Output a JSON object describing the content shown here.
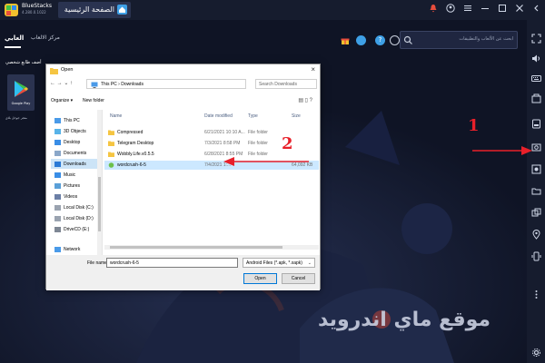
{
  "app": {
    "name": "BlueStacks",
    "version": "4.280.0.1022",
    "home_tab_label": "الصفحة الرئيسية"
  },
  "header": {
    "tab_top": "العابي",
    "tab_center": "مركز الالعاب",
    "search_placeholder": "ابحث عن الألعاب والتطبيقات"
  },
  "left_panel": {
    "title": "أضف طابع شخصي",
    "tile_label": "Google Play",
    "tile_caption": "متجر جوجل بلاي"
  },
  "dialog": {
    "title": "Open",
    "path": "This PC › Downloads",
    "search_placeholder": "Search Downloads",
    "organize_label": "Organize ▾",
    "new_folder_label": "New folder",
    "nav_items": [
      {
        "label": "This PC"
      },
      {
        "label": "3D Objects"
      },
      {
        "label": "Desktop"
      },
      {
        "label": "Documents"
      },
      {
        "label": "Downloads"
      },
      {
        "label": "Music"
      },
      {
        "label": "Pictures"
      },
      {
        "label": "Videos"
      },
      {
        "label": "Local Disk (C:)"
      },
      {
        "label": "Local Disk (D:)"
      },
      {
        "label": "DriveCD (E:)"
      },
      {
        "label": "Network"
      }
    ],
    "columns": {
      "name": "Name",
      "date": "Date modified",
      "type": "Type",
      "size": "Size"
    },
    "files": [
      {
        "name": "Compressed",
        "date": "6/21/2021 10:10 A...",
        "type": "File folder",
        "size": ""
      },
      {
        "name": "Telegram Desktop",
        "date": "7/3/2021 8:58 PM",
        "type": "File folder",
        "size": ""
      },
      {
        "name": "Wobbly.Life.v0.5.5",
        "date": "6/28/2021 8:55 PM",
        "type": "File folder",
        "size": ""
      },
      {
        "name": "wordcrush-6-5",
        "date": "7/4/2021 1:...",
        "type": "",
        "size": "64,092 KB"
      }
    ],
    "filename_label": "File name:",
    "filename_value": "wordcrush-6-5",
    "filetype_value": "Android Files (*.apk, *.xapk)",
    "open_label": "Open",
    "cancel_label": "Cancel"
  },
  "annotations": {
    "one": "1",
    "two": "2",
    "arrow_color": "#e8202a"
  },
  "watermark": "موقع ماي اندرويد",
  "colors": {
    "bg": "#0f1425",
    "accent_blue": "#3ea0e6",
    "selection": "#cce8ff"
  }
}
